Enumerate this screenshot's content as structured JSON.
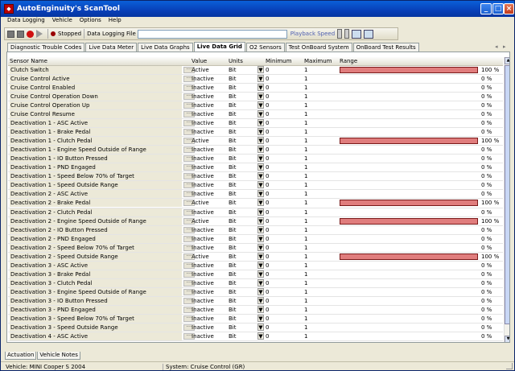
{
  "window": {
    "title": "AutoEnginuity's ScanTool"
  },
  "menu": [
    "Data Logging",
    "Vehicle",
    "Options",
    "Help"
  ],
  "toolbar": {
    "status": "Stopped",
    "log_label": "Data Logging File",
    "playback": "Playback Speed"
  },
  "tabs": [
    "Diagnostic Trouble Codes",
    "Live Data Meter",
    "Live Data Graphs",
    "Live Data Grid",
    "O2 Sensors",
    "Test OnBoard System",
    "OnBoard Test Results"
  ],
  "active_tab": "Live Data Grid",
  "grid": {
    "columns": [
      "Sensor Name",
      "Value",
      "Units",
      "Minimum",
      "Maximum",
      "Range"
    ],
    "rows": [
      {
        "name": "Clutch Switch",
        "value": "Active",
        "unit": "Bit",
        "min": "0",
        "max": "1",
        "pct": "100 %",
        "fill": 1
      },
      {
        "name": "Cruise Control Active",
        "value": "Inactive",
        "unit": "Bit",
        "min": "0",
        "max": "1",
        "pct": "0 %",
        "fill": 0
      },
      {
        "name": "Cruise Control Enabled",
        "value": "Inactive",
        "unit": "Bit",
        "min": "0",
        "max": "1",
        "pct": "0 %",
        "fill": 0
      },
      {
        "name": "Cruise Control Operation Down",
        "value": "Inactive",
        "unit": "Bit",
        "min": "0",
        "max": "1",
        "pct": "0 %",
        "fill": 0
      },
      {
        "name": "Cruise Control Operation Up",
        "value": "Inactive",
        "unit": "Bit",
        "min": "0",
        "max": "1",
        "pct": "0 %",
        "fill": 0
      },
      {
        "name": "Cruise Control Resume",
        "value": "Inactive",
        "unit": "Bit",
        "min": "0",
        "max": "1",
        "pct": "0 %",
        "fill": 0
      },
      {
        "name": "Deactivation 1 - ASC Active",
        "value": "Inactive",
        "unit": "Bit",
        "min": "0",
        "max": "1",
        "pct": "0 %",
        "fill": 0
      },
      {
        "name": "Deactivation 1 - Brake Pedal",
        "value": "Inactive",
        "unit": "Bit",
        "min": "0",
        "max": "1",
        "pct": "0 %",
        "fill": 0
      },
      {
        "name": "Deactivation 1 - Clutch Pedal",
        "value": "Active",
        "unit": "Bit",
        "min": "0",
        "max": "1",
        "pct": "100 %",
        "fill": 1
      },
      {
        "name": "Deactivation 1 - Engine Speed Outside of Range",
        "value": "Inactive",
        "unit": "Bit",
        "min": "0",
        "max": "1",
        "pct": "0 %",
        "fill": 0
      },
      {
        "name": "Deactivation 1 - IO Button Pressed",
        "value": "Inactive",
        "unit": "Bit",
        "min": "0",
        "max": "1",
        "pct": "0 %",
        "fill": 0
      },
      {
        "name": "Deactivation 1 - PND Engaged",
        "value": "Inactive",
        "unit": "Bit",
        "min": "0",
        "max": "1",
        "pct": "0 %",
        "fill": 0
      },
      {
        "name": "Deactivation 1 - Speed Below 70% of Target",
        "value": "Inactive",
        "unit": "Bit",
        "min": "0",
        "max": "1",
        "pct": "0 %",
        "fill": 0
      },
      {
        "name": "Deactivation 1 - Speed Outside Range",
        "value": "Inactive",
        "unit": "Bit",
        "min": "0",
        "max": "1",
        "pct": "0 %",
        "fill": 0
      },
      {
        "name": "Deactivation 2 - ASC Active",
        "value": "Inactive",
        "unit": "Bit",
        "min": "0",
        "max": "1",
        "pct": "0 %",
        "fill": 0
      },
      {
        "name": "Deactivation 2 - Brake Pedal",
        "value": "Active",
        "unit": "Bit",
        "min": "0",
        "max": "1",
        "pct": "100 %",
        "fill": 1
      },
      {
        "name": "Deactivation 2 - Clutch Pedal",
        "value": "Inactive",
        "unit": "Bit",
        "min": "0",
        "max": "1",
        "pct": "0 %",
        "fill": 0
      },
      {
        "name": "Deactivation 2 - Engine Speed Outside of Range",
        "value": "Active",
        "unit": "Bit",
        "min": "0",
        "max": "1",
        "pct": "100 %",
        "fill": 1
      },
      {
        "name": "Deactivation 2 - IO Button Pressed",
        "value": "Inactive",
        "unit": "Bit",
        "min": "0",
        "max": "1",
        "pct": "0 %",
        "fill": 0
      },
      {
        "name": "Deactivation 2 - PND Engaged",
        "value": "Inactive",
        "unit": "Bit",
        "min": "0",
        "max": "1",
        "pct": "0 %",
        "fill": 0
      },
      {
        "name": "Deactivation 2 - Speed Below 70% of Target",
        "value": "Inactive",
        "unit": "Bit",
        "min": "0",
        "max": "1",
        "pct": "0 %",
        "fill": 0
      },
      {
        "name": "Deactivation 2 - Speed Outside Range",
        "value": "Active",
        "unit": "Bit",
        "min": "0",
        "max": "1",
        "pct": "100 %",
        "fill": 1
      },
      {
        "name": "Deactivation 3 - ASC Active",
        "value": "Inactive",
        "unit": "Bit",
        "min": "0",
        "max": "1",
        "pct": "0 %",
        "fill": 0
      },
      {
        "name": "Deactivation 3 - Brake Pedal",
        "value": "Inactive",
        "unit": "Bit",
        "min": "0",
        "max": "1",
        "pct": "0 %",
        "fill": 0
      },
      {
        "name": "Deactivation 3 - Clutch Pedal",
        "value": "Inactive",
        "unit": "Bit",
        "min": "0",
        "max": "1",
        "pct": "0 %",
        "fill": 0
      },
      {
        "name": "Deactivation 3 - Engine Speed Outside of Range",
        "value": "Inactive",
        "unit": "Bit",
        "min": "0",
        "max": "1",
        "pct": "0 %",
        "fill": 0
      },
      {
        "name": "Deactivation 3 - IO Button Pressed",
        "value": "Inactive",
        "unit": "Bit",
        "min": "0",
        "max": "1",
        "pct": "0 %",
        "fill": 0
      },
      {
        "name": "Deactivation 3 - PND Engaged",
        "value": "Inactive",
        "unit": "Bit",
        "min": "0",
        "max": "1",
        "pct": "0 %",
        "fill": 0
      },
      {
        "name": "Deactivation 3 - Speed Below 70% of Target",
        "value": "Inactive",
        "unit": "Bit",
        "min": "0",
        "max": "1",
        "pct": "0 %",
        "fill": 0
      },
      {
        "name": "Deactivation 3 - Speed Outside Range",
        "value": "Inactive",
        "unit": "Bit",
        "min": "0",
        "max": "1",
        "pct": "0 %",
        "fill": 0
      },
      {
        "name": "Deactivation 4 - ASC Active",
        "value": "Inactive",
        "unit": "Bit",
        "min": "0",
        "max": "1",
        "pct": "0 %",
        "fill": 0
      }
    ]
  },
  "bottom_tabs": [
    "Actuation",
    "Vehicle Notes"
  ],
  "status": {
    "vehicle": "Vehicle: MINI  Cooper S  2004",
    "system": "System: Cruise Control (GR)"
  },
  "colors": {
    "range_fill": "#e07d7d",
    "title_bar": "#0a5fd8"
  }
}
